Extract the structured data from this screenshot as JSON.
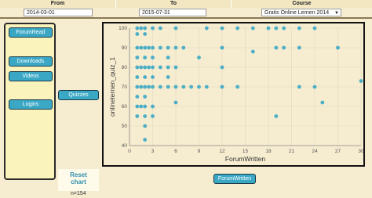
{
  "filters": {
    "from_label": "From",
    "to_label": "To",
    "course_label": "Course",
    "from_value": "2014-03-01",
    "to_value": "2015-07-31",
    "course_value": "Gratis Online Lernen 2014"
  },
  "buttons": {
    "forumread": "ForumRead",
    "downloads": "Downloads",
    "videos": "Videos",
    "logins": "Logins",
    "quizzes": "Quizzes",
    "forumwritten": "ForumWritten",
    "reset_line1": "Reset",
    "reset_line2": "chart"
  },
  "count_label": "n=154",
  "chart_data": {
    "type": "scatter",
    "xlabel": "ForumWritten",
    "ylabel": "onlinelernen_quiz_1",
    "xlim": [
      0,
      30
    ],
    "ylim": [
      40,
      100
    ],
    "xticks": [
      0,
      3,
      6,
      9,
      12,
      15,
      18,
      21,
      24,
      27,
      30
    ],
    "yticks": [
      40,
      50,
      60,
      70,
      80,
      90,
      100
    ],
    "grid": true,
    "color": "#3aa8c5",
    "points": [
      [
        1,
        100
      ],
      [
        1,
        97
      ],
      [
        1,
        90
      ],
      [
        1,
        85
      ],
      [
        1,
        80
      ],
      [
        1,
        75
      ],
      [
        1,
        70
      ],
      [
        1,
        65
      ],
      [
        1,
        60
      ],
      [
        1,
        55
      ],
      [
        1.5,
        100
      ],
      [
        1.5,
        90
      ],
      [
        1.5,
        80
      ],
      [
        1.5,
        70
      ],
      [
        1.5,
        60
      ],
      [
        2,
        100
      ],
      [
        2,
        97
      ],
      [
        2,
        90
      ],
      [
        2,
        85
      ],
      [
        2,
        80
      ],
      [
        2,
        75
      ],
      [
        2,
        70
      ],
      [
        2,
        65
      ],
      [
        2,
        60
      ],
      [
        2,
        55
      ],
      [
        2,
        50
      ],
      [
        2,
        43
      ],
      [
        2.5,
        90
      ],
      [
        2.5,
        80
      ],
      [
        2.5,
        70
      ],
      [
        3,
        100
      ],
      [
        3,
        90
      ],
      [
        3,
        85
      ],
      [
        3,
        80
      ],
      [
        3,
        75
      ],
      [
        3,
        70
      ],
      [
        3,
        60
      ],
      [
        3,
        55
      ],
      [
        4,
        100
      ],
      [
        4,
        90
      ],
      [
        4,
        80
      ],
      [
        4,
        70
      ],
      [
        5,
        90
      ],
      [
        5,
        85
      ],
      [
        5,
        80
      ],
      [
        5,
        75
      ],
      [
        5,
        70
      ],
      [
        6,
        100
      ],
      [
        6,
        90
      ],
      [
        6,
        80
      ],
      [
        6,
        70
      ],
      [
        6,
        62
      ],
      [
        7,
        90
      ],
      [
        7,
        70
      ],
      [
        8,
        70
      ],
      [
        9,
        85
      ],
      [
        9,
        70
      ],
      [
        10,
        100
      ],
      [
        10,
        70
      ],
      [
        12,
        100
      ],
      [
        12,
        90
      ],
      [
        12,
        80
      ],
      [
        12,
        70
      ],
      [
        14,
        100
      ],
      [
        14,
        70
      ],
      [
        16,
        100
      ],
      [
        16,
        88
      ],
      [
        18,
        100
      ],
      [
        19,
        100
      ],
      [
        19,
        90
      ],
      [
        19,
        55
      ],
      [
        20,
        100
      ],
      [
        20,
        90
      ],
      [
        22,
        100
      ],
      [
        22,
        90
      ],
      [
        22,
        70
      ],
      [
        24,
        100
      ],
      [
        24,
        70
      ],
      [
        25,
        62
      ],
      [
        27,
        90
      ],
      [
        30,
        73
      ]
    ]
  }
}
